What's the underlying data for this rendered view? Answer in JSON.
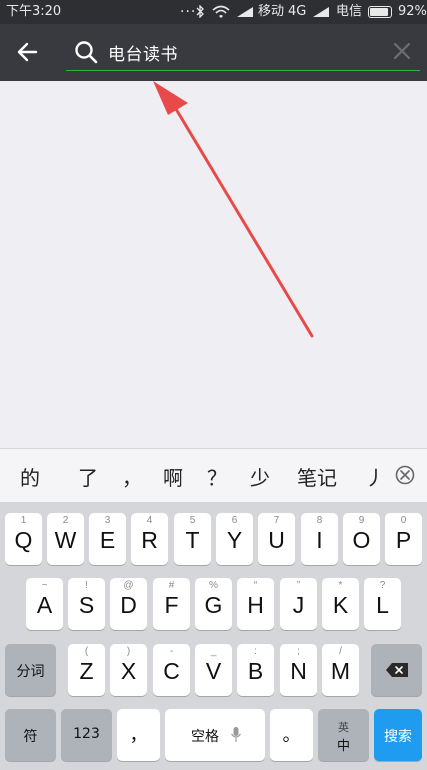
{
  "status_bar": {
    "time": "下午3:20",
    "dots": "...",
    "carrier1": "移动",
    "network": "4G",
    "carrier2": "电信",
    "battery": "92%",
    "battery_level": 0.92
  },
  "header": {
    "search_query": "电台读书",
    "accent_color": "#2fb240"
  },
  "candidates": [
    "的",
    "了",
    "，",
    "啊",
    "？",
    "少",
    "笔记",
    "丿"
  ],
  "keyboard": {
    "row1": [
      {
        "hint": "1",
        "key": "Q"
      },
      {
        "hint": "2",
        "key": "W"
      },
      {
        "hint": "3",
        "key": "E"
      },
      {
        "hint": "4",
        "key": "R"
      },
      {
        "hint": "5",
        "key": "T"
      },
      {
        "hint": "6",
        "key": "Y"
      },
      {
        "hint": "7",
        "key": "U"
      },
      {
        "hint": "8",
        "key": "I"
      },
      {
        "hint": "9",
        "key": "O"
      },
      {
        "hint": "0",
        "key": "P"
      }
    ],
    "row2": [
      {
        "hint": "~",
        "key": "A"
      },
      {
        "hint": "!",
        "key": "S"
      },
      {
        "hint": "@",
        "key": "D"
      },
      {
        "hint": "#",
        "key": "F"
      },
      {
        "hint": "%",
        "key": "G"
      },
      {
        "hint": "“",
        "key": "H"
      },
      {
        "hint": "”",
        "key": "J"
      },
      {
        "hint": "*",
        "key": "K"
      },
      {
        "hint": "?",
        "key": "L"
      }
    ],
    "row3": [
      {
        "hint": "(",
        "key": "Z"
      },
      {
        "hint": ")",
        "key": "X"
      },
      {
        "hint": "-",
        "key": "C"
      },
      {
        "hint": "_",
        "key": "V"
      },
      {
        "hint": ":",
        "key": "B"
      },
      {
        "hint": ";",
        "key": "N"
      },
      {
        "hint": "/",
        "key": "M"
      }
    ],
    "segment_label": "分词",
    "symbol_label": "符",
    "number_label": "123",
    "comma_label": "，",
    "space_label": "空格",
    "period_label": "。",
    "lang_label": "英",
    "lang_label2": "中",
    "search_label": "搜索"
  }
}
